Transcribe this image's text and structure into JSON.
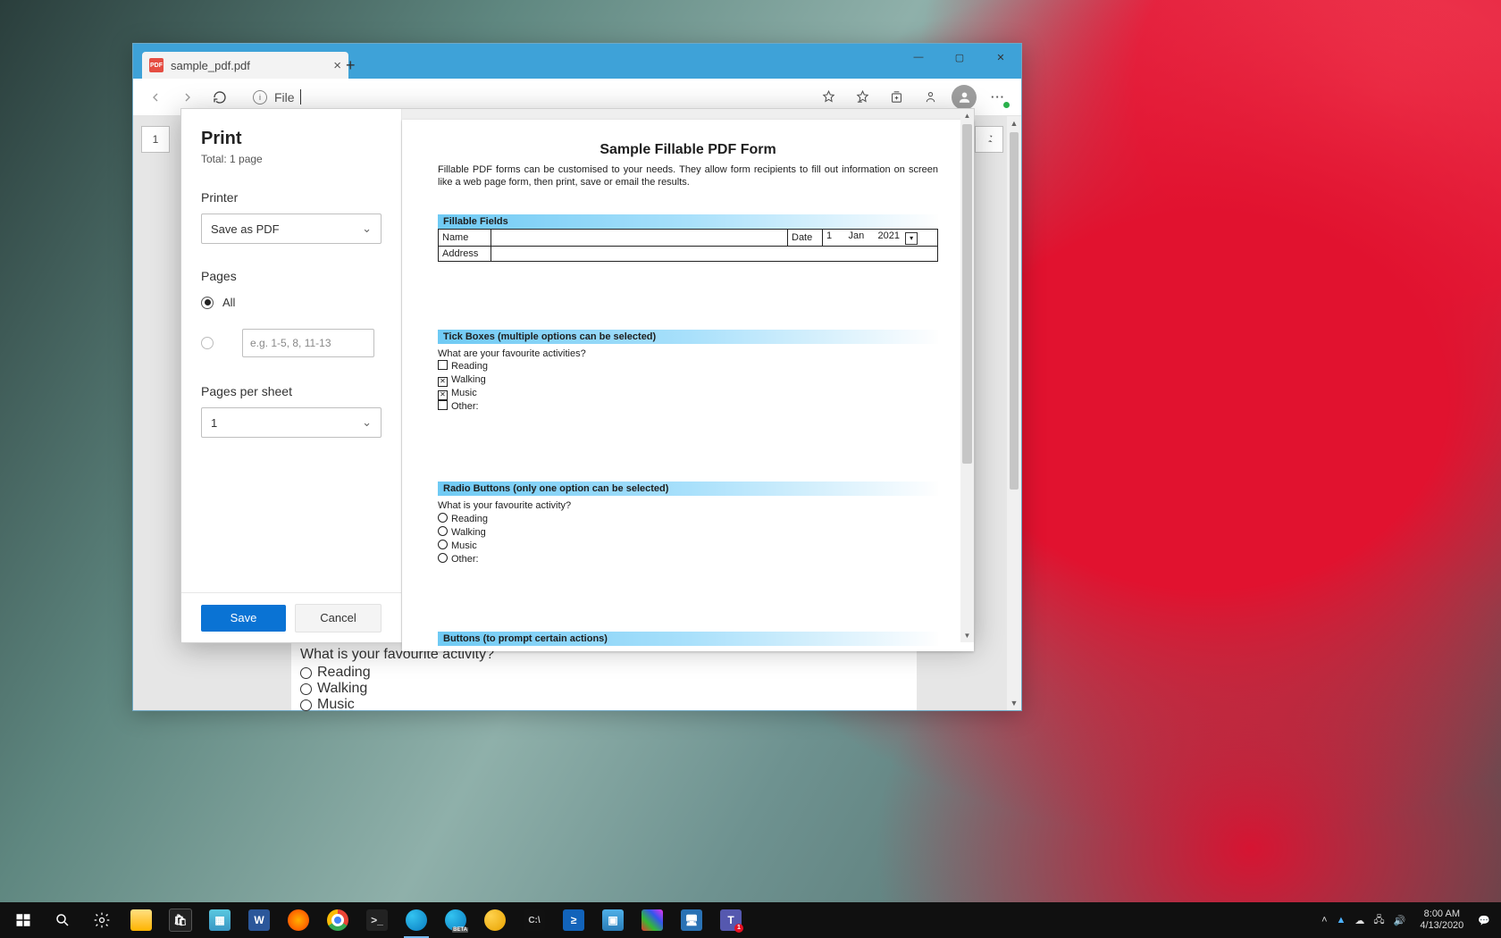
{
  "browser": {
    "tab_title": "sample_pdf.pdf",
    "url_label": "File",
    "page_indicator": "1"
  },
  "print_dialog": {
    "title": "Print",
    "subtitle": "Total: 1 page",
    "printer_label": "Printer",
    "printer_value": "Save as PDF",
    "pages_label": "Pages",
    "pages_all": "All",
    "pages_range_placeholder": "e.g. 1-5, 8, 11-13",
    "pps_label": "Pages per sheet",
    "pps_value": "1",
    "save_label": "Save",
    "cancel_label": "Cancel"
  },
  "pdf": {
    "title": "Sample Fillable PDF Form",
    "description": "Fillable PDF forms can be customised to your needs. They allow form recipients to fill out information on screen like a web page form, then print, save or email the results.",
    "sec_fillable": "Fillable Fields",
    "field_name": "Name",
    "field_date": "Date",
    "date_day": "1",
    "date_month": "Jan",
    "date_year": "2021",
    "field_address": "Address",
    "sec_tick": "Tick Boxes (multiple options can be selected)",
    "tick_q": "What are your favourite activities?",
    "opt_reading": "Reading",
    "opt_walking": "Walking",
    "opt_music": "Music",
    "opt_other": "Other:",
    "sec_radio": "Radio Buttons (only one option can be selected)",
    "radio_q": "What is your favourite activity?",
    "sec_buttons": "Buttons (to prompt certain actions)"
  },
  "underlying": {
    "question": "What is your favourite activity?",
    "o1": "Reading",
    "o2": "Walking",
    "o3": "Music"
  },
  "tray": {
    "time": "8:00 AM",
    "date": "4/13/2020"
  }
}
